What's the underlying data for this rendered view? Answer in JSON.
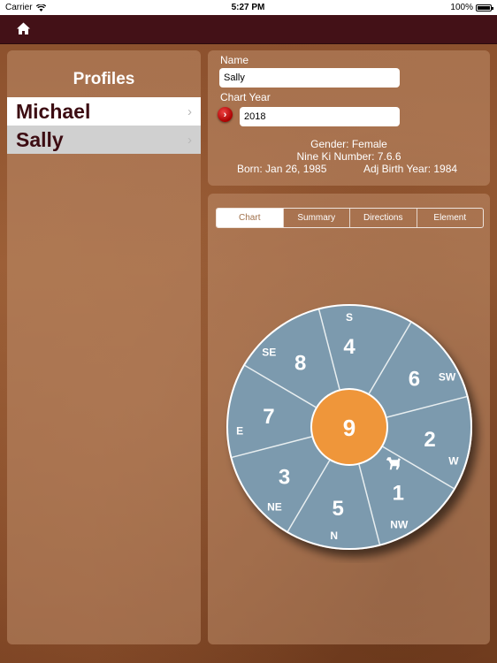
{
  "status_bar": {
    "carrier": "Carrier",
    "time": "5:27 PM",
    "battery": "100%"
  },
  "nav": {
    "home_icon": "home-icon"
  },
  "profiles": {
    "title": "Profiles",
    "items": [
      {
        "name": "Michael",
        "selected": false
      },
      {
        "name": "Sally",
        "selected": true
      }
    ]
  },
  "info": {
    "name_label": "Name",
    "name_value": "Sally",
    "year_label": "Chart Year",
    "year_value": "2018",
    "gender": "Gender: Female",
    "nine_ki": "Nine Ki Number: 7.6.6",
    "born": "Born: Jan 26, 1985",
    "adj_birth_year": "Adj Birth Year: 1984"
  },
  "tabs": [
    {
      "label": "Chart",
      "active": true
    },
    {
      "label": "Summary",
      "active": false
    },
    {
      "label": "Directions",
      "active": false
    },
    {
      "label": "Element",
      "active": false
    }
  ],
  "chart": {
    "center": "9",
    "center_color": "#ef963a",
    "sector_color": "#7c9aae",
    "sectors": [
      {
        "direction": "S",
        "number": "4"
      },
      {
        "direction": "SW",
        "number": "6"
      },
      {
        "direction": "W",
        "number": "2"
      },
      {
        "direction": "NW",
        "number": "1",
        "animal": "dog-icon"
      },
      {
        "direction": "N",
        "number": "5"
      },
      {
        "direction": "NE",
        "number": "3"
      },
      {
        "direction": "E",
        "number": "7"
      },
      {
        "direction": "SE",
        "number": "8"
      }
    ]
  }
}
